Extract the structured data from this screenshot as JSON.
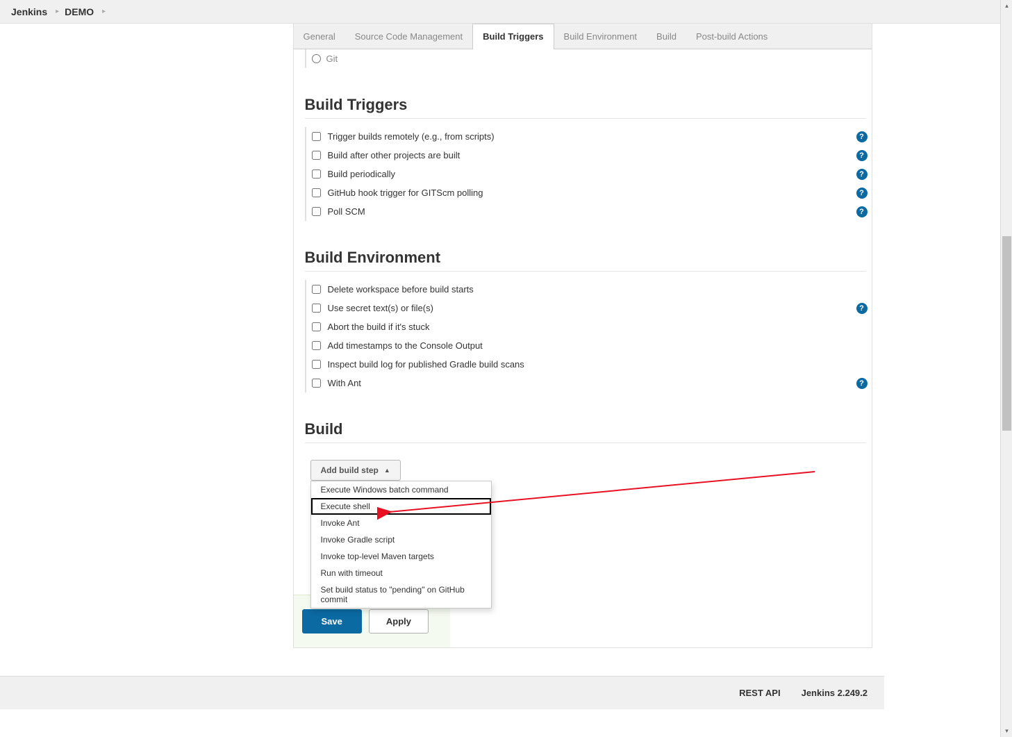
{
  "breadcrumb": {
    "root": "Jenkins",
    "project": "DEMO"
  },
  "tabs": [
    {
      "label": "General"
    },
    {
      "label": "Source Code Management"
    },
    {
      "label": "Build Triggers"
    },
    {
      "label": "Build Environment"
    },
    {
      "label": "Build"
    },
    {
      "label": "Post-build Actions"
    }
  ],
  "git_label": "Git",
  "sections": {
    "triggers": {
      "title": "Build Triggers",
      "items": [
        {
          "label": "Trigger builds remotely (e.g., from scripts)",
          "help": true
        },
        {
          "label": "Build after other projects are built",
          "help": true
        },
        {
          "label": "Build periodically",
          "help": true
        },
        {
          "label": "GitHub hook trigger for GITScm polling",
          "help": true
        },
        {
          "label": "Poll SCM",
          "help": true
        }
      ]
    },
    "environment": {
      "title": "Build Environment",
      "items": [
        {
          "label": "Delete workspace before build starts",
          "help": false
        },
        {
          "label": "Use secret text(s) or file(s)",
          "help": true
        },
        {
          "label": "Abort the build if it's stuck",
          "help": false
        },
        {
          "label": "Add timestamps to the Console Output",
          "help": false
        },
        {
          "label": "Inspect build log for published Gradle build scans",
          "help": false
        },
        {
          "label": "With Ant",
          "help": true
        }
      ]
    },
    "build": {
      "title": "Build"
    }
  },
  "add_step_label": "Add build step",
  "dropdown": [
    "Execute Windows batch command",
    "Execute shell",
    "Invoke Ant",
    "Invoke Gradle script",
    "Invoke top-level Maven targets",
    "Run with timeout",
    "Set build status to \"pending\" on GitHub commit"
  ],
  "buttons": {
    "save": "Save",
    "apply": "Apply"
  },
  "footer": {
    "rest": "REST API",
    "version": "Jenkins 2.249.2"
  }
}
